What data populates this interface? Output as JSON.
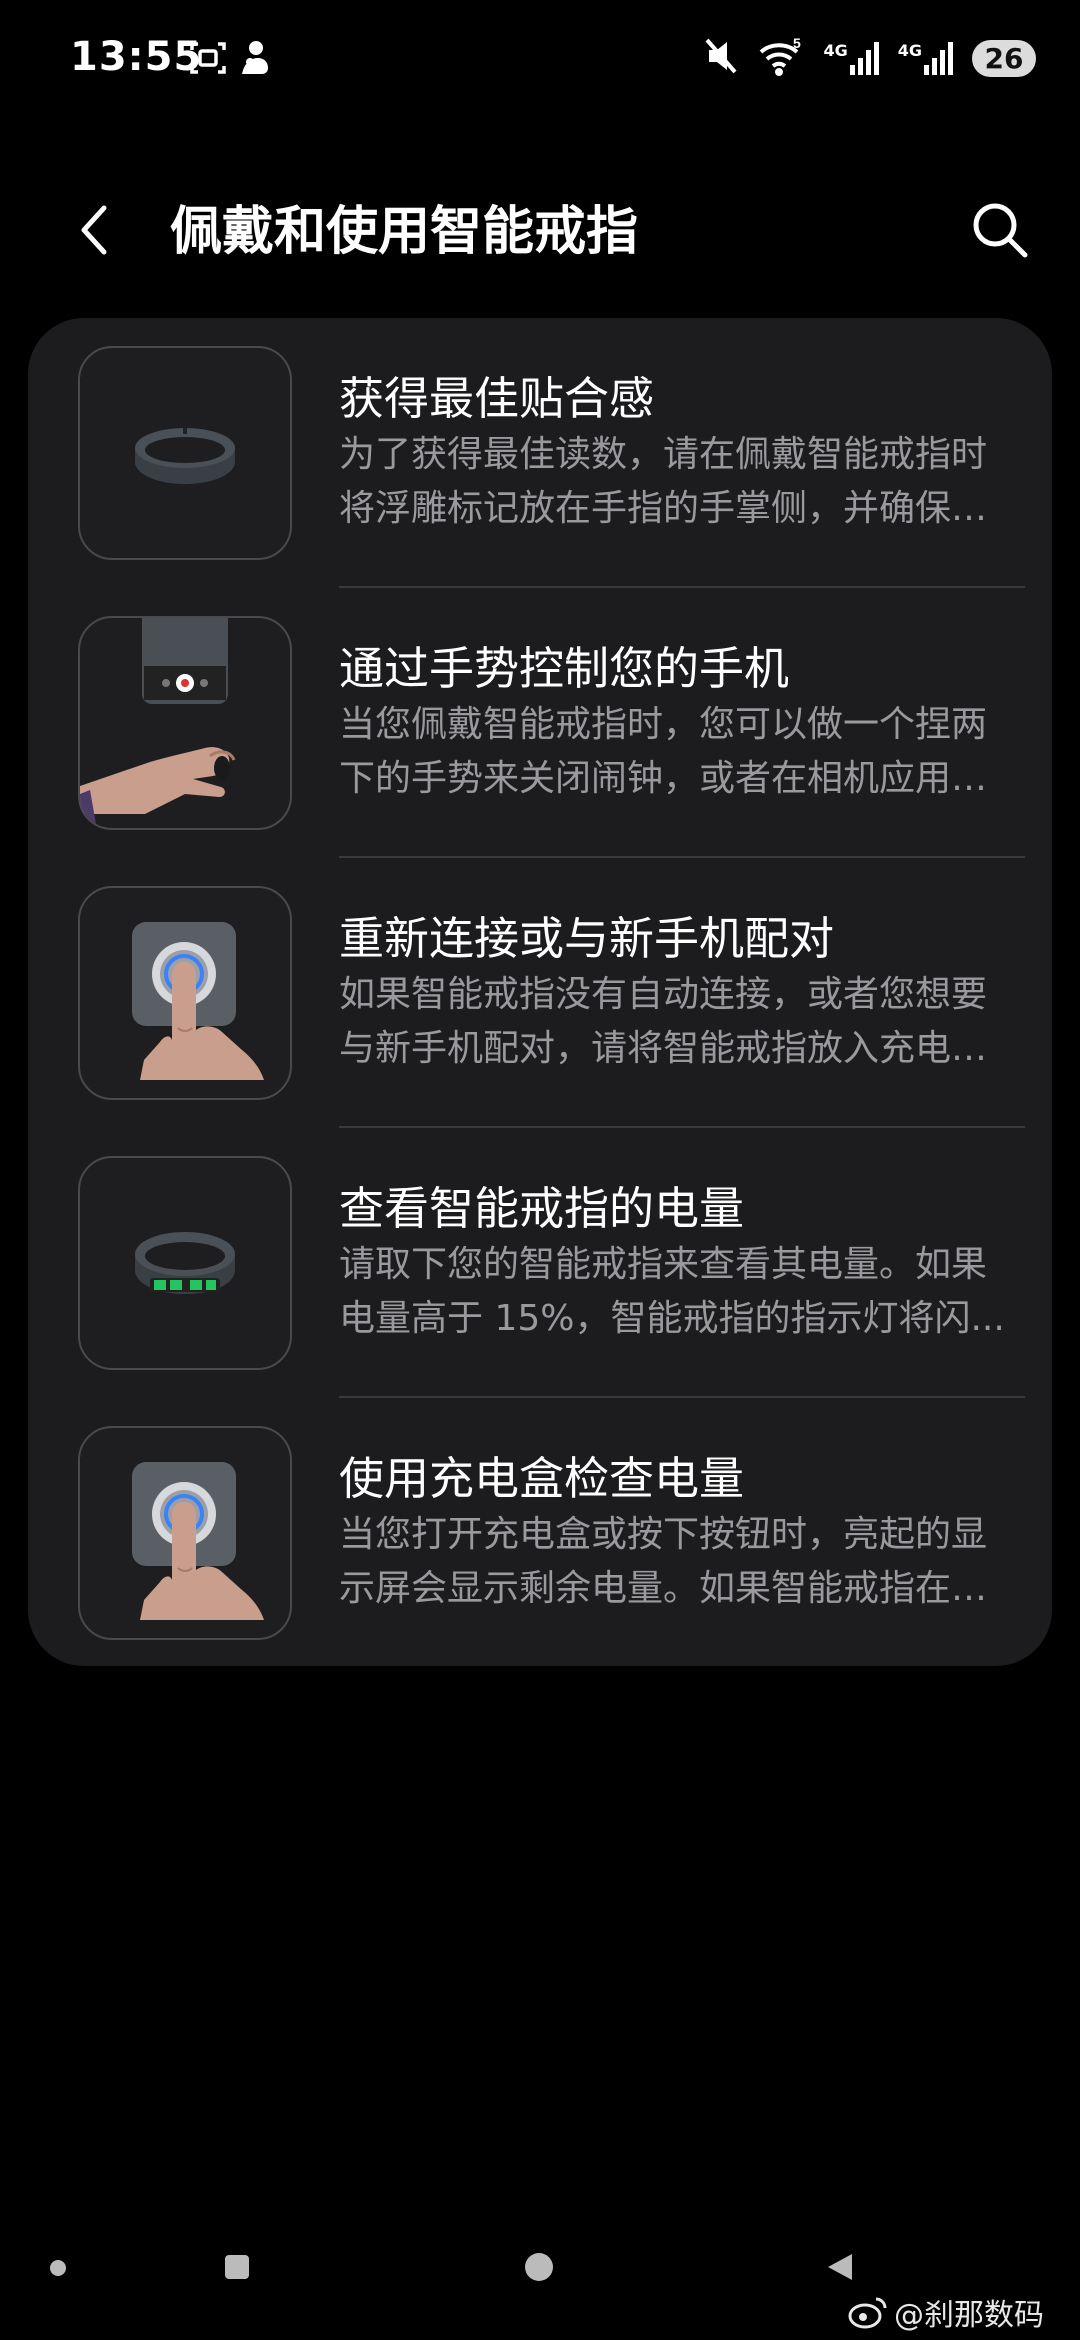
{
  "status_bar": {
    "time": "13:55",
    "network_1": "4G",
    "network_2": "4G",
    "battery": "26"
  },
  "header": {
    "title": "佩戴和使用智能戒指"
  },
  "items": [
    {
      "title": "获得最佳贴合感",
      "description": "为了获得最佳读数，请在佩戴智能戒指时将浮雕标记放在手指的手掌侧，并确保传...",
      "image": "ring-icon"
    },
    {
      "title": "通过手势控制您的手机",
      "description": "当您佩戴智能戒指时，您可以做一个捏两下的手势来关闭闹钟，或者在相机应用程...",
      "image": "hand-gesture-icon"
    },
    {
      "title": "重新连接或与新手机配对",
      "description": "如果智能戒指没有自动连接，或者您想要与新手机配对，请将智能戒指放入充电盒...",
      "image": "press-button-icon"
    },
    {
      "title": "查看智能戒指的电量",
      "description": "请取下您的智能戒指来查看其电量。如果电量高于 15%，智能戒指的指示灯将闪...",
      "image": "ring-battery-icon"
    },
    {
      "title": "使用充电盒检查电量",
      "description": "当您打开充电盒或按下按钮时，亮起的显示屏会显示剩余电量。如果智能戒指在充...",
      "image": "press-button-icon"
    }
  ],
  "watermark": "@刹那数码",
  "colors": {
    "background": "#000000",
    "card": "#1c1c1e",
    "title_text": "#ffffff",
    "desc_text": "#9a9a9e",
    "ring_led": "#22c55e",
    "button_ring": "#3b82f6"
  }
}
